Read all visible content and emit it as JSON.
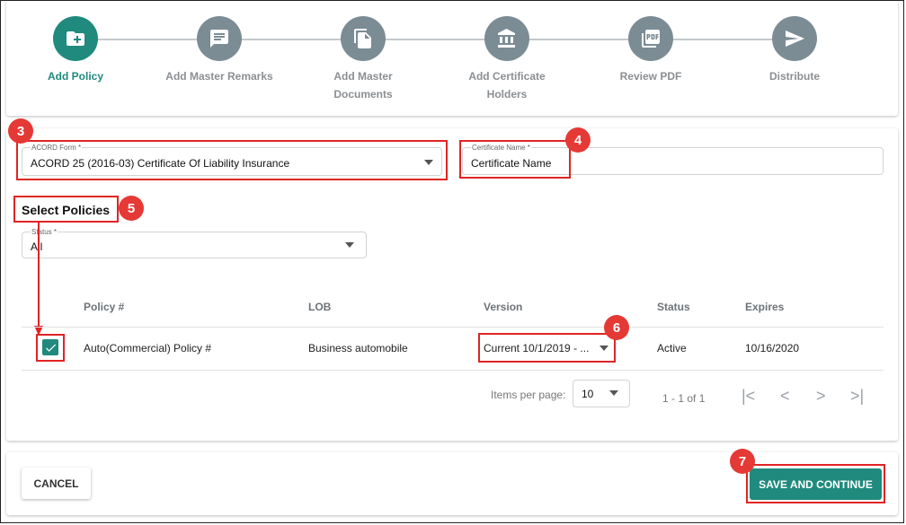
{
  "stepper": {
    "steps": [
      {
        "label": "Add Policy",
        "icon": "folder-add-icon"
      },
      {
        "label": "Add Master Remarks",
        "icon": "comment-icon"
      },
      {
        "label": "Add Master Documents",
        "icon": "documents-icon"
      },
      {
        "label": "Add Certificate Holders",
        "icon": "bank-icon"
      },
      {
        "label": "Review PDF",
        "icon": "pdf-icon"
      },
      {
        "label": "Distribute",
        "icon": "send-icon"
      }
    ],
    "active_index": 0,
    "colors": {
      "active": "#1f8a7d",
      "inactive": "#7b8c95"
    }
  },
  "form": {
    "acord_form": {
      "label": "ACORD Form *",
      "value": "ACORD 25 (2016-03) Certificate Of Liability Insurance"
    },
    "certificate_name": {
      "label": "Certificate Name *",
      "value": "Certificate Name"
    },
    "select_policies_heading": "Select Policies",
    "status": {
      "label": "Status *",
      "value": "All"
    }
  },
  "table": {
    "headers": [
      "Policy #",
      "LOB",
      "Version",
      "Status",
      "Expires"
    ],
    "rows": [
      {
        "checked": true,
        "policy": "Auto(Commercial) Policy #",
        "lob": "Business automobile",
        "version": "Current 10/1/2019 - ...",
        "status": "Active",
        "expires": "10/16/2020"
      }
    ]
  },
  "pagination": {
    "items_per_page_label": "Items per page:",
    "items_per_page": "10",
    "range": "1 - 1 of 1"
  },
  "callouts": [
    "3",
    "4",
    "5",
    "6",
    "7"
  ],
  "footer": {
    "cancel": "CANCEL",
    "save": "SAVE AND CONTINUE"
  },
  "colors": {
    "accent": "#1f8a7d",
    "annotation": "#e02424"
  }
}
